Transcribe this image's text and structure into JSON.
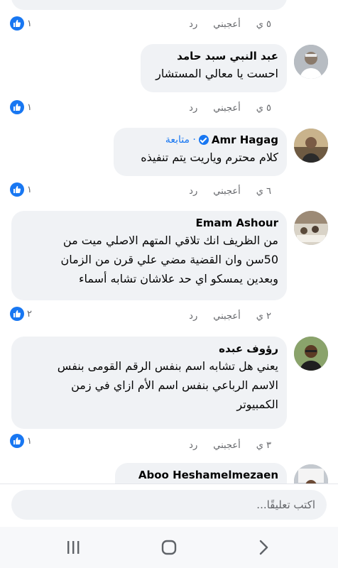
{
  "comments": [
    {
      "id": "top-partial",
      "meta": {
        "time": "٥ ي",
        "like": "أعجبني",
        "reply": "رد"
      },
      "reactions": "١"
    },
    {
      "id": "c1",
      "name": "عبد النبي سبد حامد",
      "text": "احست يا معالي المستشار",
      "meta": {
        "time": "٥ ي",
        "like": "أعجبني",
        "reply": "رد"
      },
      "reactions": "١"
    },
    {
      "id": "c2",
      "name": "Amr Hagag",
      "verified": true,
      "follow": "· متابعة",
      "text": "كلام محترم وياريت يتم تنفيذه",
      "meta": {
        "time": "٦ ي",
        "like": "أعجبني",
        "reply": "رد"
      },
      "reactions": "١"
    },
    {
      "id": "c3",
      "name": "Emam Ashour",
      "text_lines": [
        "من الظريف انك تلاقي المتهم الاصلي ميت من",
        "50سن وان القضية مضي علي قرن من الزمان",
        "وبعدين يمسكو اي حد علاشان تشابه أسماء"
      ],
      "meta": {
        "time": "٢ ي",
        "like": "أعجبني",
        "reply": "رد"
      },
      "reactions": "٢"
    },
    {
      "id": "c4",
      "name": "رؤوف عبده",
      "text_lines": [
        "يعني هل تشابه  اسم  بنفس الرقم  القومى بنفس",
        "الاسم الرباعي بنفس  اسم الأم  ازاي  في  زمن",
        "الكمبيوتر"
      ],
      "meta": {
        "time": "٣ ي",
        "like": "أعجبني",
        "reply": "رد"
      },
      "reactions": "١"
    },
    {
      "id": "c5",
      "name": "Aboo Heshamelmezaen"
    }
  ],
  "composer": {
    "placeholder": "اكتب تعليقًا..."
  },
  "colors": {
    "accent": "#1877f2",
    "bubble": "#f0f2f5",
    "meta": "#65676b"
  },
  "icons": {
    "like": "thumbs-up-icon",
    "recent": "recent-apps-icon",
    "home": "home-icon",
    "back": "back-icon"
  }
}
